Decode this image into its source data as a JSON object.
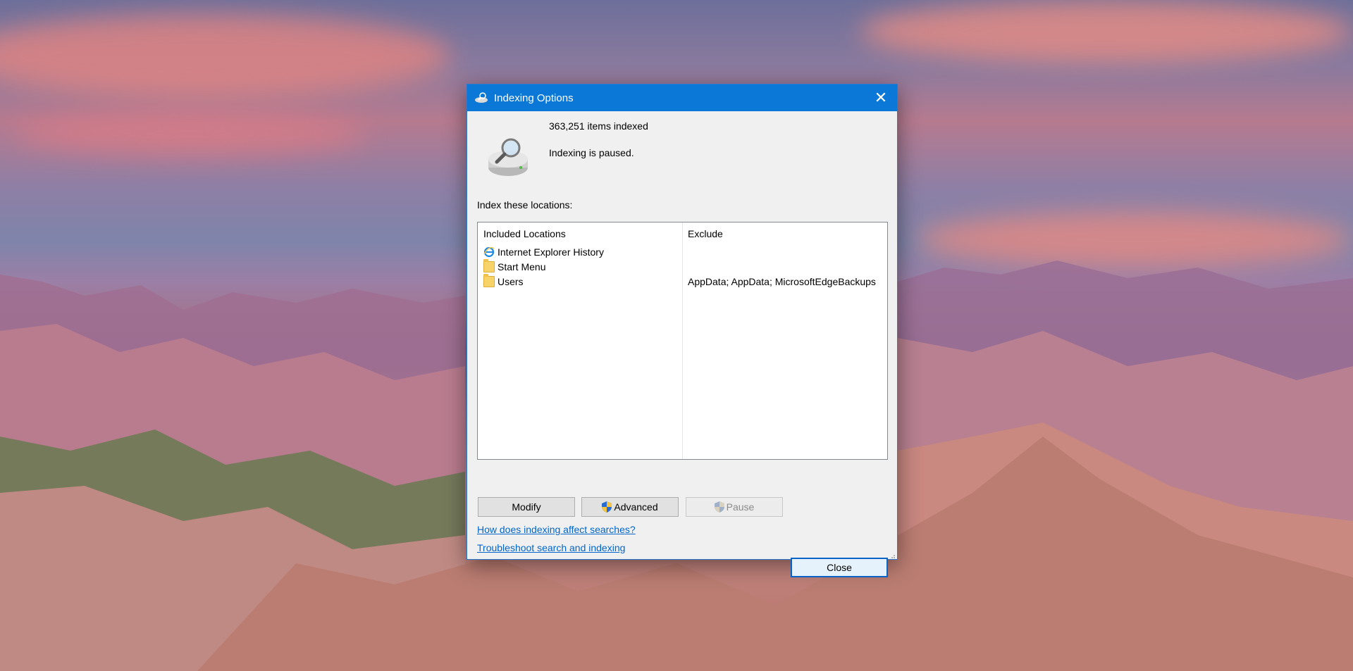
{
  "window": {
    "title": "Indexing Options",
    "close_glyph": "✕"
  },
  "summary": {
    "items_indexed": "363,251 items indexed",
    "status": "Indexing is paused."
  },
  "locations": {
    "label": "Index these locations:",
    "columns": [
      "Included Locations",
      "Exclude"
    ],
    "rows": [
      {
        "name": "Internet Explorer History",
        "icon": "internet-explorer-icon",
        "exclude": ""
      },
      {
        "name": "Start Menu",
        "icon": "folder-icon",
        "exclude": ""
      },
      {
        "name": "Users",
        "icon": "folder-icon",
        "exclude": "AppData; AppData; MicrosoftEdgeBackups"
      }
    ]
  },
  "buttons": {
    "modify": "Modify",
    "advanced": "Advanced",
    "pause": "Pause",
    "close": "Close"
  },
  "links": {
    "affect_searches": "How does indexing affect searches?",
    "troubleshoot": "Troubleshoot search and indexing"
  },
  "colors": {
    "titlebar": "#0b78d7",
    "link": "#0066cc",
    "dialog_bg": "#f0f0f0"
  }
}
